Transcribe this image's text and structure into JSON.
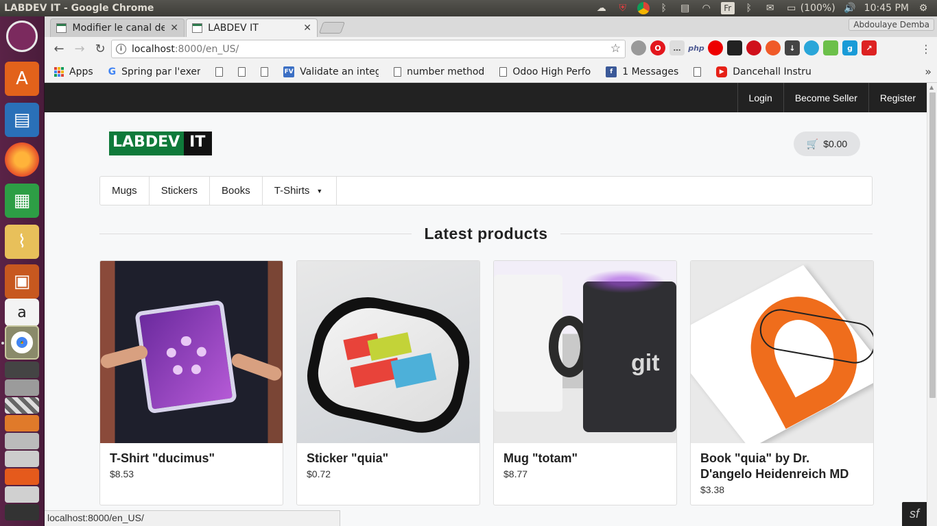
{
  "os": {
    "window_title": "LABDEV IT - Google Chrome",
    "battery": "(100%)",
    "clock": "10:45 PM",
    "keyboard_layout": "Fr"
  },
  "browser": {
    "user_name": "Abdoulaye Demba",
    "tabs": [
      {
        "label": "Modifier le canal de",
        "active": false
      },
      {
        "label": "LABDEV IT",
        "active": true
      }
    ],
    "url_host": "localhost",
    "url_rest": ":8000/en_US/",
    "bookmarks": [
      {
        "label": "Apps",
        "icon": "apps-grid-icon"
      },
      {
        "label": "Spring par l'exen",
        "icon": "google-icon"
      },
      {
        "label": "",
        "icon": "doc-icon"
      },
      {
        "label": "",
        "icon": "doc-icon"
      },
      {
        "label": "",
        "icon": "doc-icon"
      },
      {
        "label": "Validate an integ",
        "icon": "fv-icon"
      },
      {
        "label": "number method",
        "icon": "doc-icon"
      },
      {
        "label": "Odoo High Perfo",
        "icon": "doc-icon"
      },
      {
        "label": "1 Messages",
        "icon": "facebook-icon"
      },
      {
        "label": "",
        "icon": "doc-icon"
      },
      {
        "label": "Dancehall Instru",
        "icon": "youtube-icon"
      }
    ],
    "status_url": "localhost:8000/en_US/"
  },
  "site": {
    "top_links": [
      "Login",
      "Become Seller",
      "Register"
    ],
    "logo_left": "LABDEV",
    "logo_right": "IT",
    "cart_total": "$0.00",
    "categories": [
      "Mugs",
      "Stickers",
      "Books",
      "T-Shirts"
    ],
    "section_title": "Latest products",
    "products": [
      {
        "name": "T-Shirt \"ducimus\"",
        "price": "$8.53"
      },
      {
        "name": "Sticker \"quia\"",
        "price": "$0.72"
      },
      {
        "name": "Mug \"totam\"",
        "price": "$8.77"
      },
      {
        "name": "Book \"quia\" by Dr. D'angelo Heidenreich MD",
        "price": "$3.38"
      }
    ],
    "accent_green": "#0f7a3a",
    "topbar_color": "#222222"
  }
}
